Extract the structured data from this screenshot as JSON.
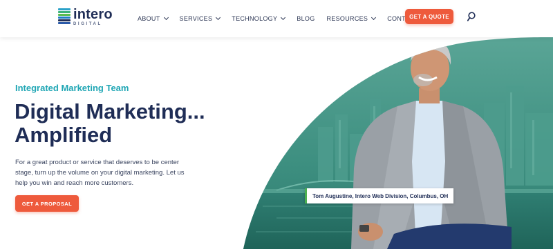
{
  "brand": {
    "name": "intero",
    "subname": "DIGITAL",
    "logo_colors": [
      "#2aa1c8",
      "#3cb37a",
      "#5bbd4f",
      "#1f7fc4",
      "#1f2d56",
      "#2b5aa8"
    ]
  },
  "nav": {
    "items": [
      {
        "label": "ABOUT",
        "has_dropdown": true
      },
      {
        "label": "SERVICES",
        "has_dropdown": true
      },
      {
        "label": "TECHNOLOGY",
        "has_dropdown": true
      },
      {
        "label": "BLOG",
        "has_dropdown": false
      },
      {
        "label": "RESOURCES",
        "has_dropdown": true
      },
      {
        "label": "CONTACT US",
        "has_dropdown": false
      }
    ],
    "cta_label": "GET A QUOTE",
    "search_icon": "search-icon"
  },
  "hero": {
    "eyebrow": "Integrated Marketing Team",
    "headline_line1": "Digital Marketing...",
    "headline_line2": "Amplified",
    "body": "For a great product or service that deserves to be center stage, turn up the volume on your digital marketing. Let us help you win and reach more customers.",
    "cta_label": "GET A PROPOSAL",
    "caption": "Tom Augustine, Intero Web Division, Columbus, OH"
  },
  "colors": {
    "accent": "#ee5a3c",
    "teal": "#1fa6b4",
    "navy": "#1f2d56",
    "hero_bg": "#3d8f80"
  }
}
